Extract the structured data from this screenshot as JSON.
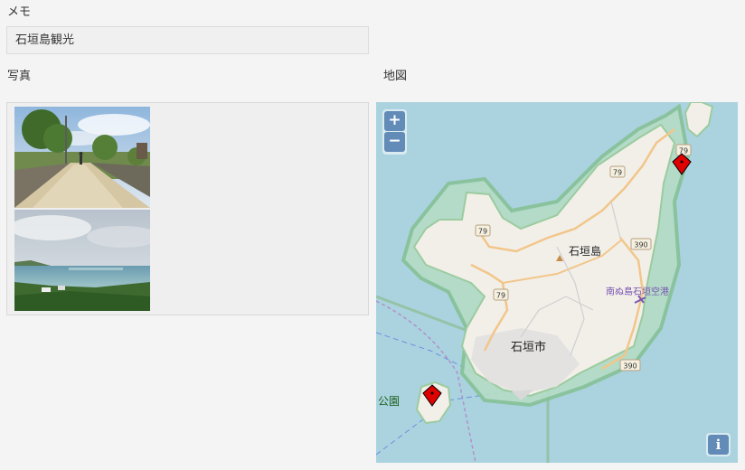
{
  "memo": {
    "label": "メモ",
    "value": "石垣島観光"
  },
  "photos": {
    "label": "写真",
    "items": [
      {
        "icon": "village-road-photo"
      },
      {
        "icon": "seaside-view-photo"
      }
    ]
  },
  "map": {
    "label": "地図",
    "zoom_in_label": "+",
    "zoom_out_label": "−",
    "info_label": "i",
    "place_labels": {
      "island": "石垣島",
      "city": "石垣市",
      "airport": "南ぬ島石垣空港",
      "park": "公園"
    },
    "road_shields": {
      "r79_a": "79",
      "r79_b": "79",
      "r79_c": "79",
      "r79_d": "79",
      "r390_a": "390",
      "r390_b": "390"
    },
    "colors": {
      "sea": "#aad3df",
      "land": "#f2efe9",
      "marker": "#e00000",
      "control": "#003c88"
    }
  }
}
